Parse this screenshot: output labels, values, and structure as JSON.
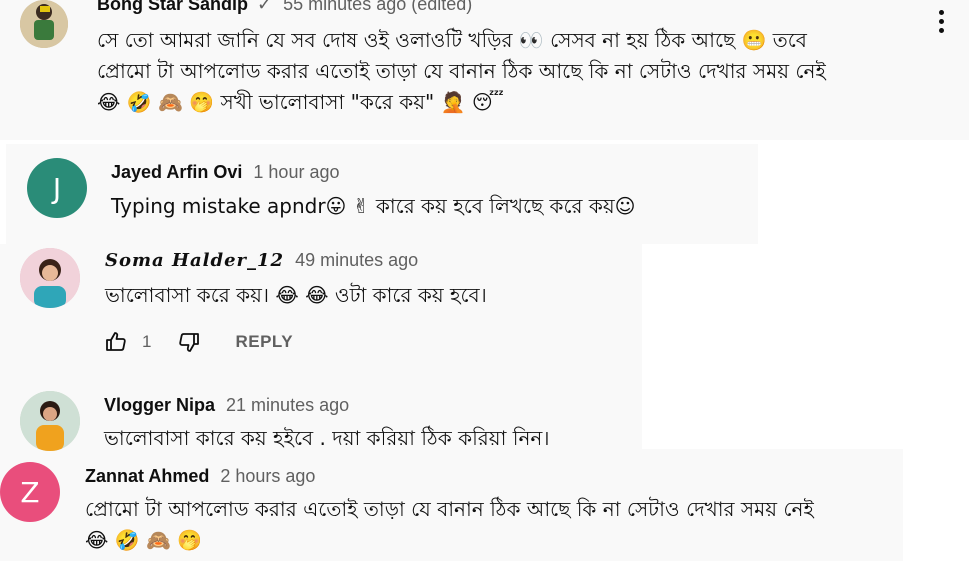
{
  "comments": [
    {
      "author": "Bong Star Sandip",
      "verified_mark": "✓",
      "time": "55 minutes ago (edited)",
      "lines": [
        "সে তো আমরা জানি যে সব দোষ ওই ওলাওটি খড়ির 👀 সেসব না হয় ঠিক আছে 😬 তবে",
        "প্রোমো টা আপলোড করার এতোই তাড়া যে বানান ঠিক আছে কি না সেটাও দেখার সময় নেই",
        "😂 🤣 🙈 🤭  সখী ভালোবাসা \"করে কয়\" 🤦 😴"
      ]
    },
    {
      "author": "Jayed Arfin Ovi",
      "time": "1 hour ago",
      "avatar_letter": "J",
      "avatar_color": "#2a8c78",
      "lines": [
        "Typing mistake apndr😛 ✌ কারে কয় হবে লিখছে করে কয়☺"
      ]
    },
    {
      "author": "Soma Halder_12",
      "time": "49 minutes ago",
      "lines": [
        "ভালোবাসা করে কয়। 😂 😂  ওটা কারে কয় হবে।"
      ],
      "likes": "1",
      "reply_label": "REPLY"
    },
    {
      "author": "Vlogger Nipa",
      "time": "21 minutes ago",
      "lines": [
        "ভালোবাসা কারে কয় হইবে . দয়া করিয়া ঠিক করিয়া নিন।"
      ]
    },
    {
      "author": "Zannat Ahmed",
      "time": "2 hours ago",
      "avatar_letter": "Z",
      "avatar_color": "#e94e7c",
      "lines": [
        "প্রোমো টা আপলোড করার এতোই তাড়া যে বানান ঠিক আছে কি না সেটাও দেখার সময় নেই",
        "😂 🤣 🙈 🤭"
      ]
    }
  ]
}
